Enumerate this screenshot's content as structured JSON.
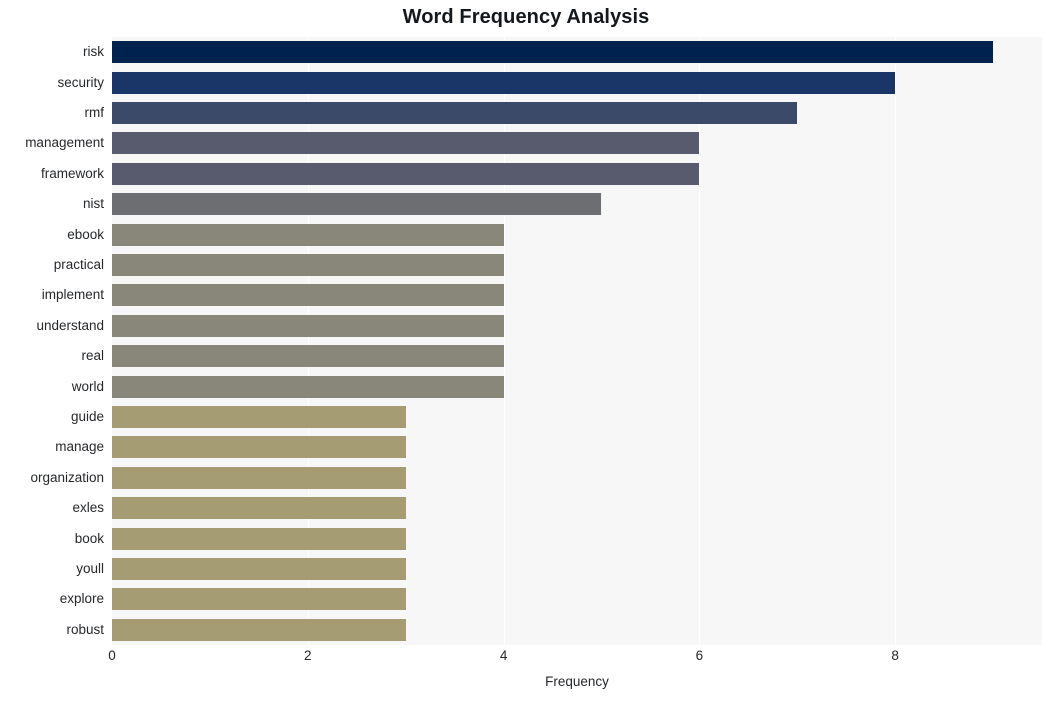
{
  "chart_data": {
    "type": "bar",
    "orientation": "horizontal",
    "title": "Word Frequency Analysis",
    "xlabel": "Frequency",
    "ylabel": "",
    "categories": [
      "risk",
      "security",
      "rmf",
      "management",
      "framework",
      "nist",
      "ebook",
      "practical",
      "implement",
      "understand",
      "real",
      "world",
      "guide",
      "manage",
      "organization",
      "exles",
      "book",
      "youll",
      "explore",
      "robust"
    ],
    "values": [
      9,
      8,
      7,
      6,
      6,
      5,
      4,
      4,
      4,
      4,
      4,
      4,
      3,
      3,
      3,
      3,
      3,
      3,
      3,
      3
    ],
    "bar_colors": [
      "#00224e",
      "#1a3568",
      "#3c4a६9",
      "#585b6e",
      "#585b6e",
      "#6d6e71",
      "#88877a",
      "#88877a",
      "#88877a",
      "#88877a",
      "#88877a",
      "#88877a",
      "#a69c74",
      "#a69c74",
      "#a69c74",
      "#a69c74",
      "#a69c74",
      "#a69c74",
      "#a69c74",
      "#a69c74"
    ],
    "xticks": [
      0,
      2,
      4,
      6,
      8
    ],
    "xtick_labels": [
      "0",
      "2",
      "4",
      "6",
      "8"
    ],
    "xlim": [
      0,
      9.5
    ],
    "grid": true,
    "grid_axis": "x",
    "plot_background": "#f7f7f8",
    "figure_background": "#ffffff",
    "colormap": "cividis"
  }
}
